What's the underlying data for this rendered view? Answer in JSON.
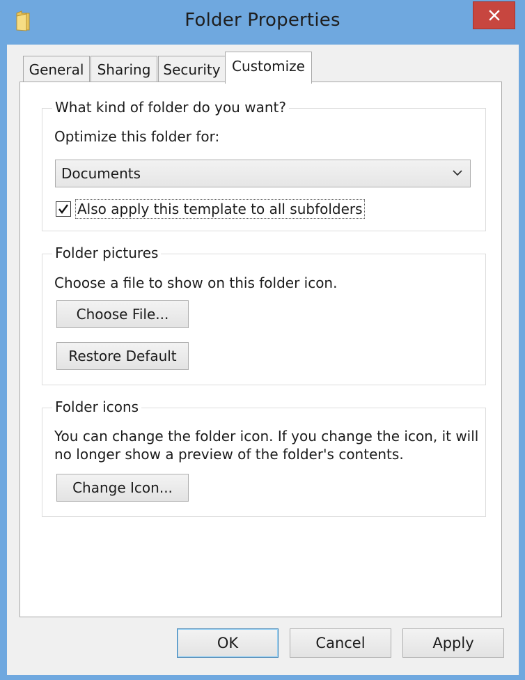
{
  "window": {
    "title": "Folder Properties",
    "close_label": "✕"
  },
  "tabs": [
    {
      "label": "General"
    },
    {
      "label": "Sharing"
    },
    {
      "label": "Security"
    },
    {
      "label": "Customize"
    }
  ],
  "active_tab": "Customize",
  "folder_type_group": {
    "title": "What kind of folder do you want?",
    "optimize_label": "Optimize this folder for:",
    "dropdown_value": "Documents",
    "subfolders_checkbox": {
      "label": "Also apply this template to all subfolders",
      "checked": true
    }
  },
  "folder_pictures_group": {
    "title": "Folder pictures",
    "description": "Choose a file to show on this folder icon.",
    "choose_file_label": "Choose File...",
    "restore_default_label": "Restore Default"
  },
  "folder_icons_group": {
    "title": "Folder icons",
    "description_line1": "You can change the folder icon. If you change the icon, it will",
    "description_line2": "no longer show a preview of the folder's contents.",
    "change_icon_label": "Change Icon..."
  },
  "footer": {
    "ok_label": "OK",
    "cancel_label": "Cancel",
    "apply_label": "Apply"
  },
  "colors": {
    "frame": "#6fa8df",
    "close_button": "#c7463f",
    "dialog_bg": "#f0f0f0",
    "panel_bg": "#ffffff",
    "folder_yellow": "#f1d36b"
  }
}
